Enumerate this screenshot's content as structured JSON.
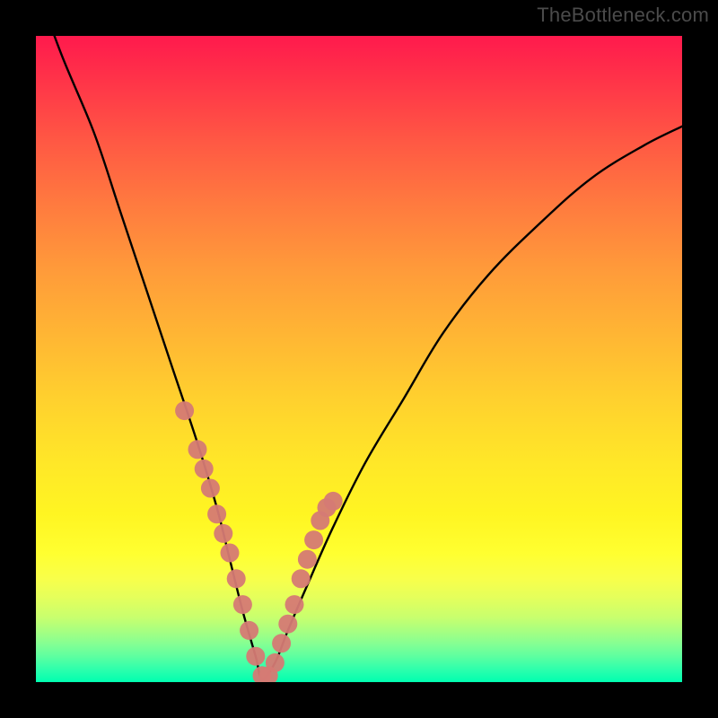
{
  "watermark": {
    "text": "TheBottleneck.com"
  },
  "colors": {
    "background": "#000000",
    "curve_stroke": "#000000",
    "marker_fill": "#d57a74",
    "marker_stroke": "#d57a74"
  },
  "chart_data": {
    "type": "line",
    "title": "",
    "xlabel": "",
    "ylabel": "",
    "xlim": [
      0,
      100
    ],
    "ylim": [
      0,
      100
    ],
    "grid": false,
    "legend": false,
    "notes": "No axes, ticks, or labels are visible. x and y are normalized 0–100 across the plot area; y is read from vertical position (0 = bottom, 100 = top). Curve is a V-shaped bottleneck profile with minimum around x≈35.",
    "series": [
      {
        "name": "curve",
        "x": [
          0,
          4,
          9,
          13,
          17,
          21,
          25,
          28,
          30,
          32,
          34,
          35,
          37,
          39,
          42,
          46,
          51,
          57,
          63,
          70,
          78,
          86,
          94,
          100
        ],
        "y": [
          108,
          97,
          85,
          73,
          61,
          49,
          37,
          27,
          19,
          11,
          4,
          0.5,
          3,
          8,
          15,
          24,
          34,
          44,
          54,
          63,
          71,
          78,
          83,
          86
        ]
      },
      {
        "name": "markers",
        "x": [
          23,
          25,
          26,
          27,
          28,
          29,
          30,
          31,
          32,
          33,
          34,
          35,
          36,
          37,
          38,
          39,
          40,
          41,
          42,
          43,
          44,
          45,
          46
        ],
        "y": [
          42,
          36,
          33,
          30,
          26,
          23,
          20,
          16,
          12,
          8,
          4,
          1,
          1,
          3,
          6,
          9,
          12,
          16,
          19,
          22,
          25,
          27,
          28
        ]
      }
    ]
  }
}
